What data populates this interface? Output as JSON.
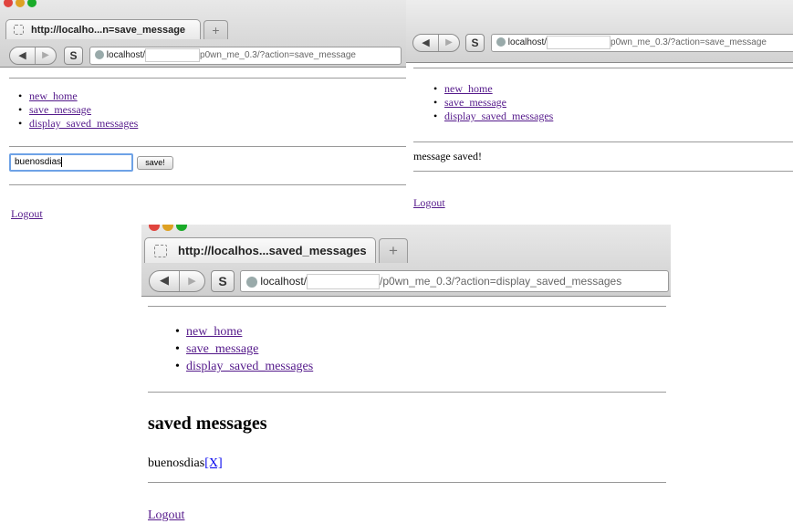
{
  "panel_save": {
    "tab_title": "http://localho...n=save_message",
    "new_tab_label": "+",
    "s_button": "S",
    "url_host": "localhost/",
    "url_path": "p0wn_me_0.3/?action=save_message",
    "nav": [
      "new_home",
      "save_message",
      "display_saved_messages"
    ],
    "input_value": "buenosdias",
    "save_label": "save!",
    "logout": "Logout"
  },
  "panel_saved": {
    "s_button": "S",
    "url_host": "localhost/",
    "url_path": "p0wn_me_0.3/?action=save_message",
    "nav": [
      "new_home",
      "save_message",
      "display_saved_messages"
    ],
    "status": "message saved!",
    "logout": "Logout"
  },
  "panel_display": {
    "tab_title": "http://localhos...saved_messages",
    "new_tab_label": "+",
    "s_button": "S",
    "url_host": "localhost/",
    "url_path": "/p0wn_me_0.3/?action=display_saved_messages",
    "nav": [
      "new_home",
      "save_message",
      "display_saved_messages"
    ],
    "heading": "saved messages",
    "message": "buenosdias",
    "delete_link": "[X]",
    "logout": "Logout"
  },
  "colors": {
    "traffic_close": "#e0443e",
    "traffic_min": "#dea123",
    "traffic_max": "#1aab29",
    "link_visited": "#551a8b",
    "link_unvisited": "#0000ee",
    "input_focus": "#6ea2e6"
  }
}
